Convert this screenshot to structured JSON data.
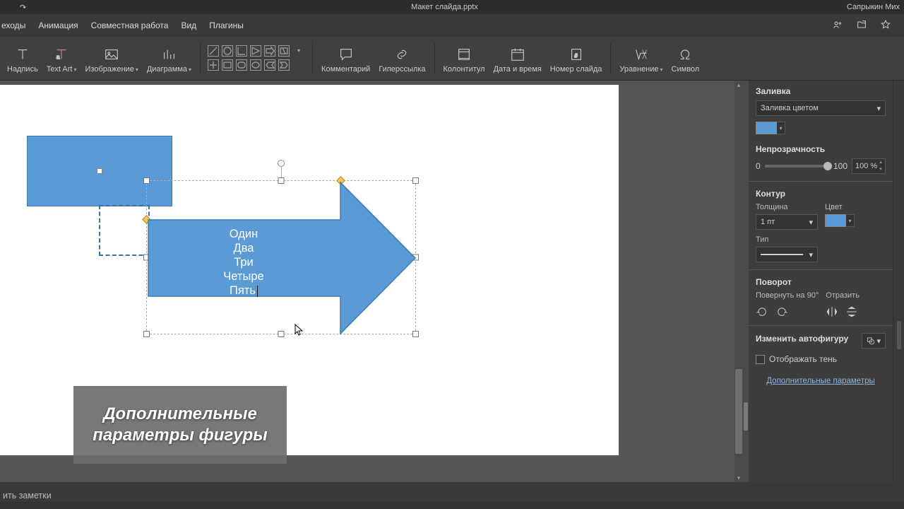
{
  "title": {
    "filename": "Макет слайда.pptx",
    "user": "Сапрыкин Мих",
    "redo_icon": "↷"
  },
  "menu": {
    "items": [
      "еходы",
      "Анимация",
      "Совместная работа",
      "Вид",
      "Плагины"
    ]
  },
  "toolbar": {
    "textbox": "Надпись",
    "textart": "Text Art",
    "image": "Изображение",
    "chart": "Диаграмма",
    "comment": "Комментарий",
    "hyperlink": "Гиперссылка",
    "headerfooter": "Колонтитул",
    "datetime": "Дата и время",
    "slidenum": "Номер слайда",
    "equation": "Уравнение",
    "symbol": "Символ"
  },
  "slide": {
    "arrow_lines": [
      "Один",
      "Два",
      "Три",
      "Четыре",
      "Пять"
    ],
    "caption": "Дополнительные параметры фигуры"
  },
  "panel": {
    "fill_h": "Заливка",
    "fill_type": "Заливка цветом",
    "opacity_h": "Непрозрачность",
    "op_min": "0",
    "op_max": "100",
    "op_val": "100 %",
    "stroke_h": "Контур",
    "width_l": "Толщина",
    "width_v": "1 пт",
    "color_l": "Цвет",
    "type_l": "Тип",
    "rotate_h": "Поворот",
    "rot90": "Повернуть на 90°",
    "flip": "Отразить",
    "change_h": "Изменить автофигуру",
    "shadow": "Отображать тень",
    "advanced": "Дополнительные параметры"
  },
  "footer": {
    "notes": "ить заметки"
  }
}
